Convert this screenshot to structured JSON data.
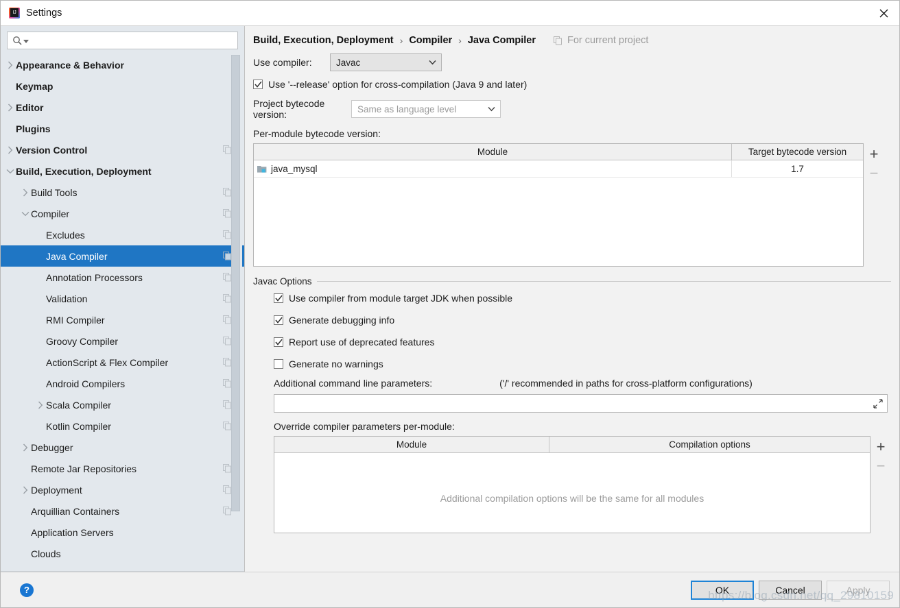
{
  "window": {
    "title": "Settings",
    "logo_icon": "intellij-idea-logo",
    "close_icon": "close-icon"
  },
  "sidebar": {
    "search": {
      "placeholder": "",
      "value": "",
      "icon": "search-icon",
      "dropdown_icon": "chevron-down-icon"
    },
    "items": [
      {
        "label": "Appearance & Behavior",
        "level": 0,
        "expander": "collapsed",
        "copy": false,
        "selected": false
      },
      {
        "label": "Keymap",
        "level": 0,
        "expander": "none",
        "copy": false,
        "selected": false
      },
      {
        "label": "Editor",
        "level": 0,
        "expander": "collapsed",
        "copy": false,
        "selected": false
      },
      {
        "label": "Plugins",
        "level": 0,
        "expander": "none",
        "copy": false,
        "selected": false
      },
      {
        "label": "Version Control",
        "level": 0,
        "expander": "collapsed",
        "copy": true,
        "selected": false
      },
      {
        "label": "Build, Execution, Deployment",
        "level": 0,
        "expander": "expanded",
        "copy": false,
        "selected": false
      },
      {
        "label": "Build Tools",
        "level": 1,
        "expander": "collapsed",
        "copy": true,
        "selected": false
      },
      {
        "label": "Compiler",
        "level": 1,
        "expander": "expanded",
        "copy": true,
        "selected": false
      },
      {
        "label": "Excludes",
        "level": 2,
        "expander": "none",
        "copy": true,
        "selected": false
      },
      {
        "label": "Java Compiler",
        "level": 2,
        "expander": "none",
        "copy": true,
        "selected": true
      },
      {
        "label": "Annotation Processors",
        "level": 2,
        "expander": "none",
        "copy": true,
        "selected": false
      },
      {
        "label": "Validation",
        "level": 2,
        "expander": "none",
        "copy": true,
        "selected": false
      },
      {
        "label": "RMI Compiler",
        "level": 2,
        "expander": "none",
        "copy": true,
        "selected": false
      },
      {
        "label": "Groovy Compiler",
        "level": 2,
        "expander": "none",
        "copy": true,
        "selected": false
      },
      {
        "label": "ActionScript & Flex Compiler",
        "level": 2,
        "expander": "none",
        "copy": true,
        "selected": false
      },
      {
        "label": "Android Compilers",
        "level": 2,
        "expander": "none",
        "copy": true,
        "selected": false
      },
      {
        "label": "Scala Compiler",
        "level": 2,
        "expander": "collapsed",
        "copy": true,
        "selected": false
      },
      {
        "label": "Kotlin Compiler",
        "level": 2,
        "expander": "none",
        "copy": true,
        "selected": false
      },
      {
        "label": "Debugger",
        "level": 1,
        "expander": "collapsed",
        "copy": false,
        "selected": false
      },
      {
        "label": "Remote Jar Repositories",
        "level": 1,
        "expander": "none",
        "copy": true,
        "selected": false
      },
      {
        "label": "Deployment",
        "level": 1,
        "expander": "collapsed",
        "copy": true,
        "selected": false
      },
      {
        "label": "Arquillian Containers",
        "level": 1,
        "expander": "none",
        "copy": true,
        "selected": false
      },
      {
        "label": "Application Servers",
        "level": 1,
        "expander": "none",
        "copy": false,
        "selected": false
      },
      {
        "label": "Clouds",
        "level": 1,
        "expander": "none",
        "copy": false,
        "selected": false
      }
    ],
    "selection_color": "#1f76c4"
  },
  "main": {
    "breadcrumb": [
      "Build, Execution, Deployment",
      "Compiler",
      "Java Compiler"
    ],
    "breadcrumb_separator": "›",
    "scope_label": "For current project",
    "use_compiler_label": "Use compiler:",
    "use_compiler_value": "Javac",
    "release_option_label": "Use '--release' option for cross-compilation (Java 9 and later)",
    "release_option_checked": true,
    "project_bytecode_label": "Project bytecode version:",
    "project_bytecode_value": "Same as language level",
    "project_bytecode_disabled": true,
    "per_module_label": "Per-module bytecode version:",
    "module_table": {
      "columns": [
        "Module",
        "Target bytecode version"
      ],
      "rows": [
        {
          "module": "java_mysql",
          "target": "1.7"
        }
      ],
      "add_label": "+",
      "remove_label": "−"
    },
    "javac_options": {
      "title": "Javac Options",
      "checkboxes": [
        {
          "label": "Use compiler from module target JDK when possible",
          "checked": true
        },
        {
          "label": "Generate debugging info",
          "checked": true
        },
        {
          "label": "Report use of deprecated features",
          "checked": true
        },
        {
          "label": "Generate no warnings",
          "checked": false
        }
      ],
      "additional_params_label": "Additional command line parameters:",
      "additional_params_hint": "('/' recommended in paths for cross-platform configurations)",
      "additional_params_value": "",
      "expand_icon": "expand-icon",
      "override_label": "Override compiler parameters per-module:",
      "override_table": {
        "columns": [
          "Module",
          "Compilation options"
        ],
        "empty_message": "Additional compilation options will be the same for all modules",
        "add_label": "+",
        "remove_label": "−"
      }
    }
  },
  "footer": {
    "help_label": "?",
    "ok_label": "OK",
    "cancel_label": "Cancel",
    "apply_label": "Apply",
    "apply_disabled": true,
    "watermark": "https://blog.csdn.net/qq_29810159"
  }
}
